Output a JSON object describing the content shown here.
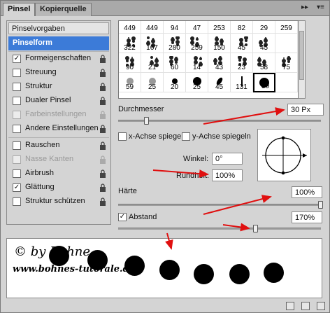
{
  "tabs": [
    {
      "label": "Pinsel",
      "active": true
    },
    {
      "label": "Kopierquelle",
      "active": false
    }
  ],
  "panel_controls": {
    "expand": "▸▸",
    "menu": "▾≡"
  },
  "left": {
    "presets_label": "Pinselvorgaben",
    "items": [
      {
        "label": "Pinselform",
        "selected": true,
        "checkbox": false,
        "checked": false,
        "lock": false,
        "disabled": false
      },
      {
        "label": "Formeigenschaften",
        "selected": false,
        "checkbox": true,
        "checked": true,
        "lock": true,
        "disabled": false
      },
      {
        "label": "Streuung",
        "selected": false,
        "checkbox": true,
        "checked": false,
        "lock": true,
        "disabled": false
      },
      {
        "label": "Struktur",
        "selected": false,
        "checkbox": true,
        "checked": false,
        "lock": true,
        "disabled": false
      },
      {
        "label": "Dualer Pinsel",
        "selected": false,
        "checkbox": true,
        "checked": false,
        "lock": true,
        "disabled": false
      },
      {
        "label": "Farbeinstellungen",
        "selected": false,
        "checkbox": true,
        "checked": false,
        "lock": true,
        "disabled": true
      },
      {
        "label": "Andere Einstellungen",
        "selected": false,
        "checkbox": true,
        "checked": false,
        "lock": true,
        "disabled": false
      },
      {
        "label": "Rauschen",
        "selected": false,
        "checkbox": true,
        "checked": false,
        "lock": true,
        "disabled": false
      },
      {
        "label": "Nasse Kanten",
        "selected": false,
        "checkbox": true,
        "checked": false,
        "lock": true,
        "disabled": true
      },
      {
        "label": "Airbrush",
        "selected": false,
        "checkbox": true,
        "checked": false,
        "lock": true,
        "disabled": false
      },
      {
        "label": "Glättung",
        "selected": false,
        "checkbox": true,
        "checked": true,
        "lock": true,
        "disabled": false
      },
      {
        "label": "Struktur schützen",
        "selected": false,
        "checkbox": true,
        "checked": false,
        "lock": true,
        "disabled": false
      }
    ]
  },
  "brush_grid": {
    "rows": [
      [
        "449",
        "449",
        "94",
        "47",
        "253",
        "82",
        "29",
        "259"
      ],
      [
        "322",
        "167",
        "280",
        "259",
        "150",
        "45",
        "45",
        ""
      ],
      [
        "90",
        "21",
        "60",
        "14",
        "43",
        "23",
        "58",
        "75"
      ],
      [
        "59",
        "25",
        "20",
        "25",
        "45",
        "131",
        "30",
        ""
      ]
    ],
    "selected_value": "30"
  },
  "durchmesser": {
    "label": "Durchmesser",
    "value": "30 Px"
  },
  "flip_x": {
    "label": "x-Achse spiegeln",
    "checked": false
  },
  "flip_y": {
    "label": "y-Achse spiegeln",
    "checked": false
  },
  "winkel": {
    "label": "Winkel:",
    "value": "0°"
  },
  "rundheit": {
    "label": "Rundheit:",
    "value": "100%"
  },
  "haerte": {
    "label": "Härte",
    "value": "100%"
  },
  "abstand": {
    "label": "Abstand",
    "value": "170%",
    "checked": true
  },
  "preview": {
    "watermark_line1": "© by Bohne",
    "watermark_line2": "www.bohnes-tutorale.de"
  },
  "colors": {
    "selection": "#3c7bd8",
    "annotation_arrow": "#e01010"
  }
}
